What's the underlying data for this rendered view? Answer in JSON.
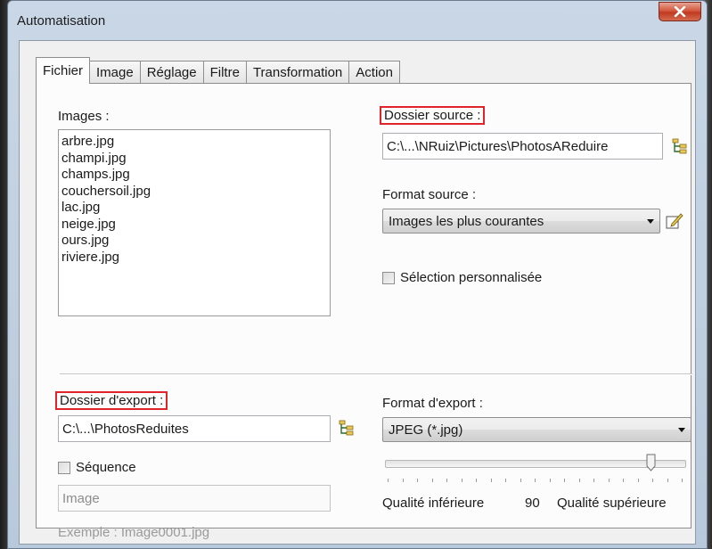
{
  "window": {
    "title": "Automatisation",
    "close_label": "x"
  },
  "tabs": [
    {
      "label": "Fichier",
      "active": true
    },
    {
      "label": "Image",
      "active": false
    },
    {
      "label": "Réglage",
      "active": false
    },
    {
      "label": "Filtre",
      "active": false
    },
    {
      "label": "Transformation",
      "active": false
    },
    {
      "label": "Action",
      "active": false
    }
  ],
  "images": {
    "label": "Images :",
    "items": [
      "arbre.jpg",
      "champi.jpg",
      "champs.jpg",
      "couchersoil.jpg",
      "lac.jpg",
      "neige.jpg",
      "ours.jpg",
      "riviere.jpg"
    ]
  },
  "source": {
    "folder_label": "Dossier source :",
    "folder_value": "C:\\...\\NRuiz\\Pictures\\PhotosAReduire",
    "format_label": "Format source :",
    "format_value": "Images les plus courantes",
    "custom_selection_label": "Sélection personnalisée",
    "custom_selection_checked": false
  },
  "export": {
    "folder_label": "Dossier d'export :",
    "folder_value": "C:\\...\\PhotosReduites",
    "sequence_label": "Séquence",
    "sequence_checked": false,
    "sequence_name_value": "Image",
    "example_text": "Exemple : Image0001.jpg",
    "format_label": "Format d'export :",
    "format_value": "JPEG (*.jpg)",
    "quality_min_label": "Qualité inférieure",
    "quality_value": "90",
    "quality_max_label": "Qualité supérieure",
    "quality_fraction": 0.9
  },
  "colors": {
    "highlight": "#e0242b",
    "close_button": "#c0391f"
  },
  "icons": {
    "folder_browse": "folder-tree-icon",
    "format_edit": "edit-pencil-icon",
    "close": "close-icon",
    "dropdown": "chevron-down-icon"
  }
}
